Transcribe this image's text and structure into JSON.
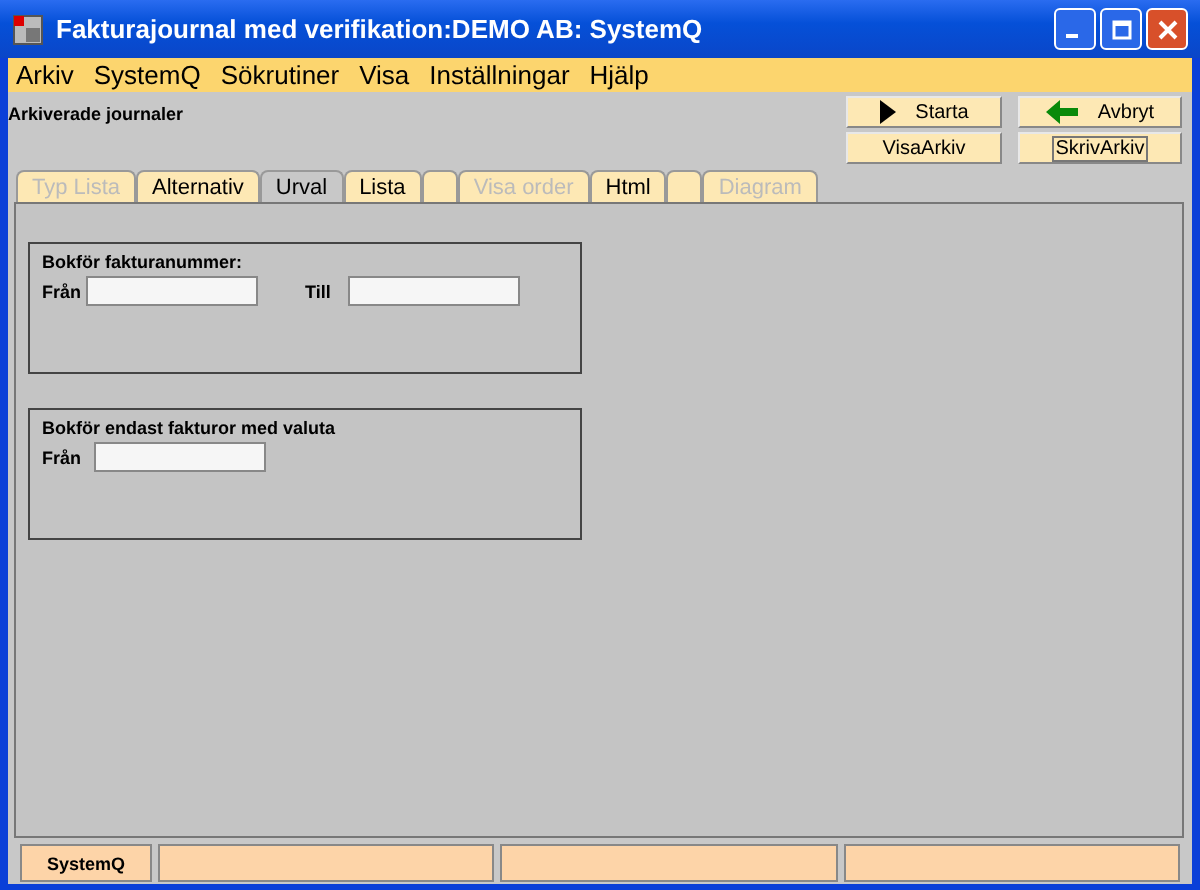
{
  "window": {
    "title": "Fakturajournal med verifikation:DEMO AB: SystemQ"
  },
  "menu": [
    "Arkiv",
    "SystemQ",
    "Sökrutiner",
    "Visa",
    "Inställningar",
    "Hjälp"
  ],
  "heading": "Arkiverade journaler",
  "buttons": [
    {
      "label": "Starta",
      "kind": "play"
    },
    {
      "label": "Avbryt",
      "kind": "back"
    },
    {
      "label": "VisaArkiv",
      "kind": "plain"
    },
    {
      "label": "SkrivArkiv",
      "kind": "focused"
    }
  ],
  "tabs": [
    {
      "label": "Typ Lista",
      "selected": false,
      "disabled": true
    },
    {
      "label": "Alternativ",
      "selected": false,
      "disabled": false
    },
    {
      "label": "Urval",
      "selected": true,
      "disabled": false
    },
    {
      "label": "Lista",
      "selected": false,
      "disabled": false
    },
    {
      "selected": false
    },
    {
      "label": "Visa order",
      "selected": false,
      "disabled": true
    },
    {
      "label": "Html",
      "selected": false,
      "disabled": false
    },
    {
      "selected": false
    },
    {
      "label": "Diagram",
      "selected": false,
      "disabled": true
    }
  ],
  "groups": [
    {
      "title": "Bokför fakturanummer:",
      "fields": [
        {
          "label": "Från"
        },
        {
          "label": "Till"
        }
      ]
    },
    {
      "title": "Bokför endast fakturor med valuta",
      "fields": [
        {
          "label": "Från"
        }
      ]
    }
  ],
  "status_bar": {
    "label": "SystemQ"
  }
}
